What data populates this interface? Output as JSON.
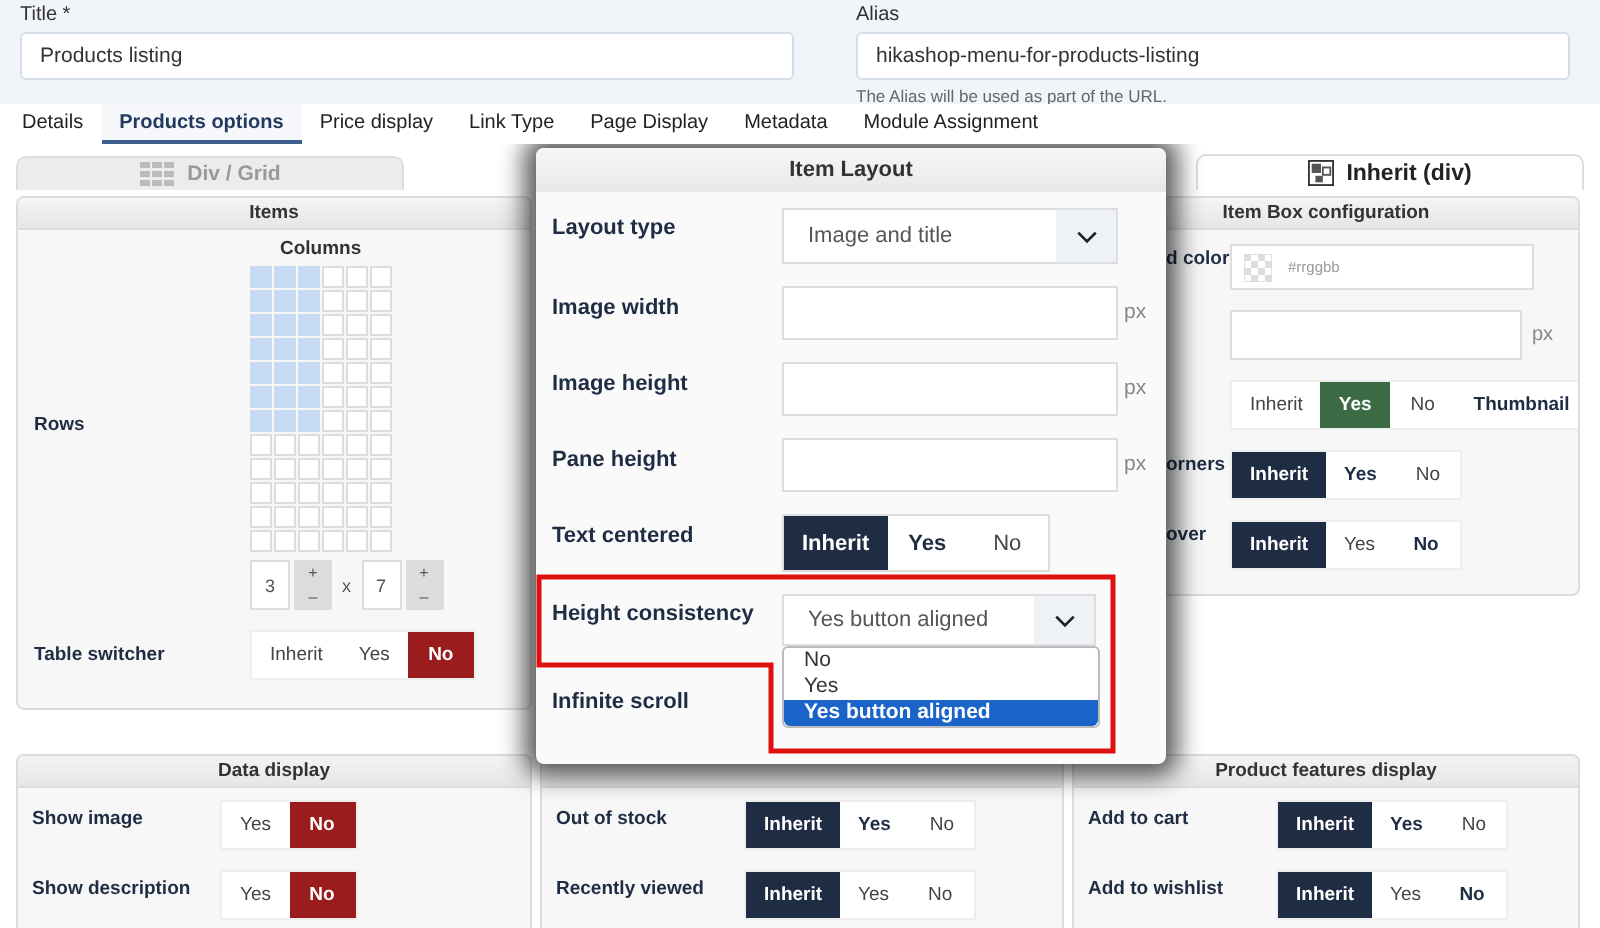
{
  "title_field": {
    "label": "Title *",
    "value": "Products listing"
  },
  "alias_field": {
    "label": "Alias",
    "value": "hikashop-menu-for-products-listing",
    "hint": "The Alias will be used as part of the URL."
  },
  "tabs": [
    {
      "label": "Details",
      "selected": false
    },
    {
      "label": "Products options",
      "selected": true
    },
    {
      "label": "Price display",
      "selected": false
    },
    {
      "label": "Link Type",
      "selected": false
    },
    {
      "label": "Page Display",
      "selected": false
    },
    {
      "label": "Metadata",
      "selected": false
    },
    {
      "label": "Module Assignment",
      "selected": false
    }
  ],
  "layout_tabs": [
    {
      "label": "Div / Grid",
      "selected": false
    },
    {
      "label": "Inherit (div)",
      "selected": true
    }
  ],
  "items_panel": {
    "title": "Items",
    "rows_label": "Rows",
    "columns_label": "Columns",
    "grid": [
      {
        "cells": [
          {
            "selected": true
          },
          {
            "selected": true
          },
          {
            "selected": true
          },
          {
            "selected": false
          },
          {
            "selected": false
          },
          {
            "selected": false
          }
        ]
      },
      {
        "cells": [
          {
            "selected": true
          },
          {
            "selected": true
          },
          {
            "selected": true
          },
          {
            "selected": false
          },
          {
            "selected": false
          },
          {
            "selected": false
          }
        ]
      },
      {
        "cells": [
          {
            "selected": true
          },
          {
            "selected": true
          },
          {
            "selected": true
          },
          {
            "selected": false
          },
          {
            "selected": false
          },
          {
            "selected": false
          }
        ]
      },
      {
        "cells": [
          {
            "selected": true
          },
          {
            "selected": true
          },
          {
            "selected": true
          },
          {
            "selected": false
          },
          {
            "selected": false
          },
          {
            "selected": false
          }
        ]
      },
      {
        "cells": [
          {
            "selected": true
          },
          {
            "selected": true
          },
          {
            "selected": true
          },
          {
            "selected": false
          },
          {
            "selected": false
          },
          {
            "selected": false
          }
        ]
      },
      {
        "cells": [
          {
            "selected": true
          },
          {
            "selected": true
          },
          {
            "selected": true
          },
          {
            "selected": false
          },
          {
            "selected": false
          },
          {
            "selected": false
          }
        ]
      },
      {
        "cells": [
          {
            "selected": true
          },
          {
            "selected": true
          },
          {
            "selected": true
          },
          {
            "selected": false
          },
          {
            "selected": false
          },
          {
            "selected": false
          }
        ]
      },
      {
        "cells": [
          {
            "selected": false
          },
          {
            "selected": false
          },
          {
            "selected": false
          },
          {
            "selected": false
          },
          {
            "selected": false
          },
          {
            "selected": false
          }
        ]
      },
      {
        "cells": [
          {
            "selected": false
          },
          {
            "selected": false
          },
          {
            "selected": false
          },
          {
            "selected": false
          },
          {
            "selected": false
          },
          {
            "selected": false
          }
        ]
      },
      {
        "cells": [
          {
            "selected": false
          },
          {
            "selected": false
          },
          {
            "selected": false
          },
          {
            "selected": false
          },
          {
            "selected": false
          },
          {
            "selected": false
          }
        ]
      },
      {
        "cells": [
          {
            "selected": false
          },
          {
            "selected": false
          },
          {
            "selected": false
          },
          {
            "selected": false
          },
          {
            "selected": false
          },
          {
            "selected": false
          }
        ]
      },
      {
        "cells": [
          {
            "selected": false
          },
          {
            "selected": false
          },
          {
            "selected": false
          },
          {
            "selected": false
          },
          {
            "selected": false
          },
          {
            "selected": false
          }
        ]
      }
    ],
    "spinners": [
      {
        "value": "3",
        "plus": "+",
        "minus": "–"
      },
      {
        "value": "7",
        "plus": "+",
        "minus": "–"
      }
    ],
    "times": "x",
    "table_switcher": {
      "label": "Table switcher",
      "options": [
        {
          "label": "Inherit",
          "selected": false,
          "bold": false
        },
        {
          "label": "Yes",
          "selected": false,
          "bold": false
        },
        {
          "label": "No",
          "selected": true,
          "bold": true,
          "color": "#9b1c1c"
        }
      ]
    }
  },
  "item_box_panel": {
    "title": "Item Box configuration",
    "rows": [
      {
        "kind": "color",
        "label": "d color",
        "placeholder": "#rrggbb"
      },
      {
        "kind": "input",
        "unit": "px"
      },
      {
        "kind": "toggle",
        "options": [
          {
            "label": "Inherit",
            "selected": false,
            "bold": false
          },
          {
            "label": "Yes",
            "selected": true,
            "bold": true,
            "color": "#3a6b45"
          },
          {
            "label": "No",
            "selected": false,
            "bold": false
          },
          {
            "label": "Thumbnail",
            "selected": false,
            "bold": true
          }
        ]
      },
      {
        "kind": "toggle",
        "label": "orners",
        "options": [
          {
            "label": "Inherit",
            "selected": true,
            "bold": true,
            "color": "#1f2d44"
          },
          {
            "label": "Yes",
            "selected": false,
            "bold": true
          },
          {
            "label": "No",
            "selected": false,
            "bold": false
          }
        ]
      },
      {
        "kind": "toggle",
        "label": "over",
        "options": [
          {
            "label": "Inherit",
            "selected": true,
            "bold": true,
            "color": "#1f2d44"
          },
          {
            "label": "Yes",
            "selected": false,
            "bold": false
          },
          {
            "label": "No",
            "selected": false,
            "bold": true
          }
        ]
      }
    ]
  },
  "bottom_panels": [
    {
      "title": "Data display",
      "rows": [
        {
          "label": "Show image",
          "options": [
            {
              "label": "Yes",
              "selected": false,
              "bold": false
            },
            {
              "label": "No",
              "selected": true,
              "bold": true,
              "color": "#9b1c1c"
            }
          ]
        },
        {
          "label": "Show description",
          "options": [
            {
              "label": "Yes",
              "selected": false,
              "bold": false
            },
            {
              "label": "No",
              "selected": true,
              "bold": true,
              "color": "#9b1c1c"
            }
          ]
        }
      ]
    },
    {
      "rows": [
        {
          "label": "Out of stock",
          "options": [
            {
              "label": "Inherit",
              "selected": true,
              "bold": true,
              "color": "#1f2d44"
            },
            {
              "label": "Yes",
              "selected": false,
              "bold": true
            },
            {
              "label": "No",
              "selected": false,
              "bold": false
            }
          ]
        },
        {
          "label": "Recently viewed",
          "options": [
            {
              "label": "Inherit",
              "selected": true,
              "bold": true,
              "color": "#1f2d44"
            },
            {
              "label": "Yes",
              "selected": false,
              "bold": false
            },
            {
              "label": "No",
              "selected": false,
              "bold": false
            }
          ]
        }
      ]
    },
    {
      "title": "Product features display",
      "rows": [
        {
          "label": "Add to cart",
          "options": [
            {
              "label": "Inherit",
              "selected": true,
              "bold": true,
              "color": "#1f2d44"
            },
            {
              "label": "Yes",
              "selected": false,
              "bold": true
            },
            {
              "label": "No",
              "selected": false,
              "bold": false
            }
          ]
        },
        {
          "label": "Add to wishlist",
          "options": [
            {
              "label": "Inherit",
              "selected": true,
              "bold": true,
              "color": "#1f2d44"
            },
            {
              "label": "Yes",
              "selected": false,
              "bold": false
            },
            {
              "label": "No",
              "selected": false,
              "bold": true
            }
          ]
        }
      ]
    }
  ],
  "modal": {
    "title": "Item Layout",
    "rows": [
      {
        "kind": "select",
        "label": "Layout type",
        "value": "Image and title",
        "expanded": false,
        "highlighted": false
      },
      {
        "kind": "input",
        "label": "Image width",
        "unit": "px"
      },
      {
        "kind": "input",
        "label": "Image height",
        "unit": "px"
      },
      {
        "kind": "input",
        "label": "Pane height",
        "unit": "px"
      },
      {
        "kind": "toggle",
        "label": "Text centered",
        "options": [
          {
            "label": "Inherit",
            "selected": true,
            "bold": true,
            "color": "#1f2d44"
          },
          {
            "label": "Yes",
            "selected": false,
            "bold": true
          },
          {
            "label": "No",
            "selected": false,
            "bold": false
          }
        ]
      },
      {
        "kind": "select",
        "label": "Height consistency",
        "value": "Yes button aligned",
        "expanded": true,
        "highlighted": true,
        "options": [
          {
            "label": "No",
            "selected": false
          },
          {
            "label": "Yes",
            "selected": false
          },
          {
            "label": "Yes button aligned",
            "selected": true
          }
        ]
      },
      {
        "kind": "label",
        "label": "Infinite scroll"
      }
    ]
  }
}
